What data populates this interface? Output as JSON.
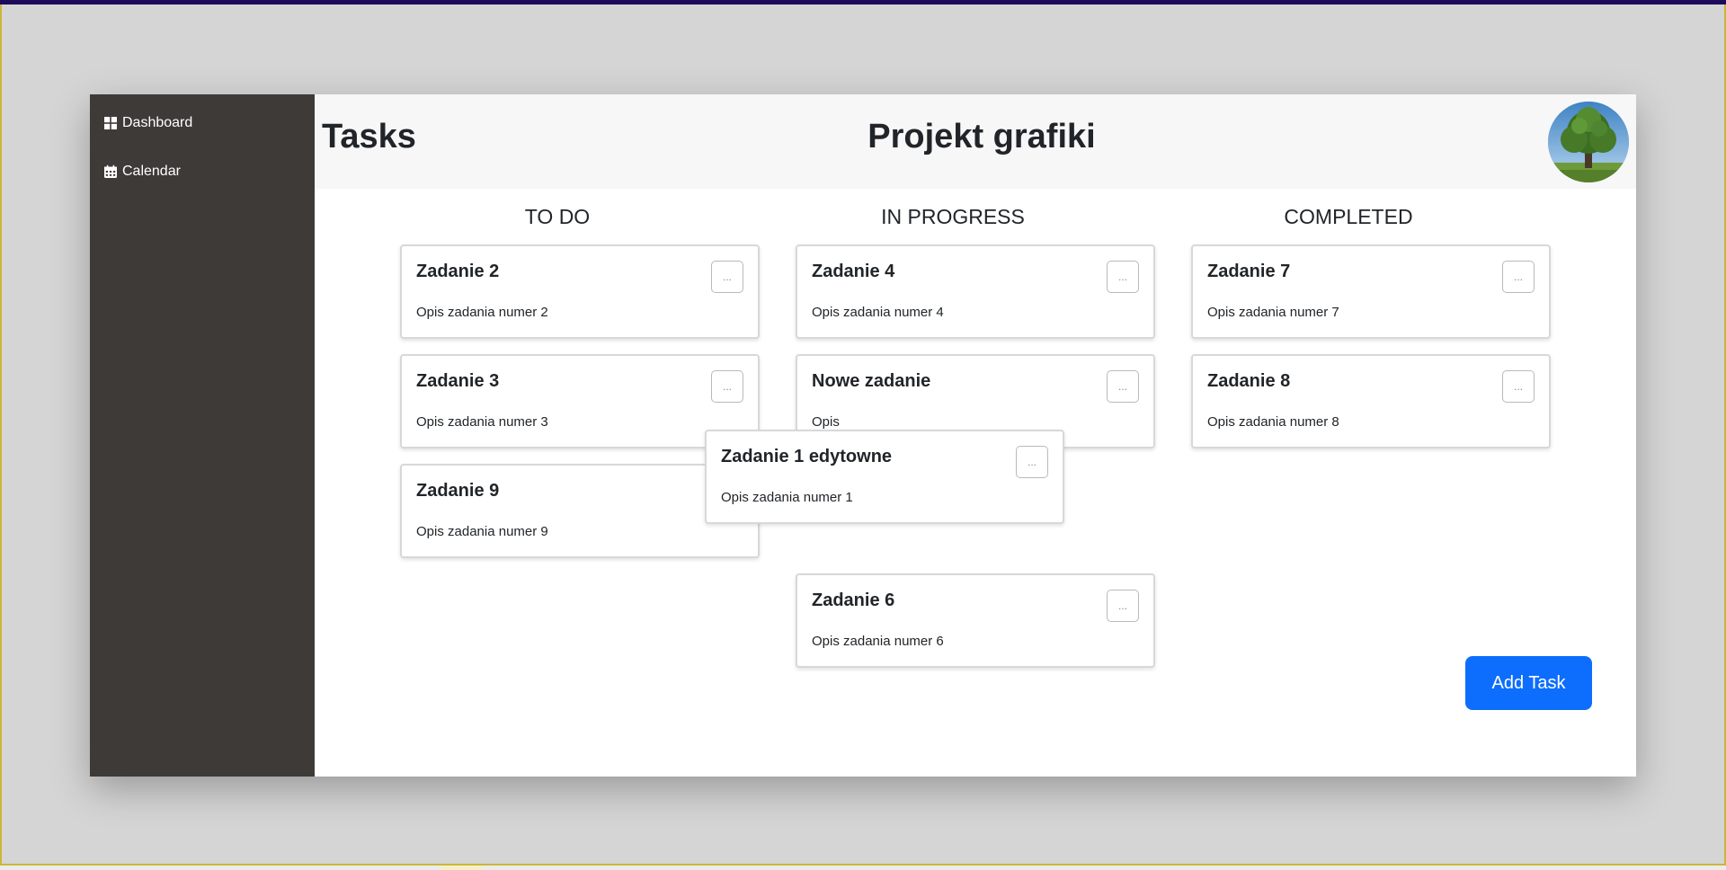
{
  "sidebar": {
    "items": [
      {
        "label": "Dashboard",
        "icon": "dashboard-icon"
      },
      {
        "label": "Calendar",
        "icon": "calendar-icon"
      }
    ]
  },
  "header": {
    "title": "Tasks",
    "project": "Projekt grafiki"
  },
  "columns": [
    {
      "title": "TO DO"
    },
    {
      "title": "IN PROGRESS"
    },
    {
      "title": "COMPLETED"
    }
  ],
  "cards": {
    "todo": [
      {
        "title": "Zadanie 2",
        "desc": "Opis zadania numer 2",
        "menu": "..."
      },
      {
        "title": "Zadanie 3",
        "desc": "Opis zadania numer 3",
        "menu": "..."
      },
      {
        "title": "Zadanie 9",
        "desc": "Opis zadania numer 9",
        "menu": "..."
      }
    ],
    "in_progress": [
      {
        "title": "Zadanie 4",
        "desc": "Opis zadania numer 4",
        "menu": "..."
      },
      {
        "title": "Nowe zadanie",
        "desc": "Opis",
        "menu": "..."
      },
      {
        "title": "Zadanie 6",
        "desc": "Opis zadania numer 6",
        "menu": "..."
      }
    ],
    "completed": [
      {
        "title": "Zadanie 7",
        "desc": "Opis zadania numer 7",
        "menu": "..."
      },
      {
        "title": "Zadanie 8",
        "desc": "Opis zadania numer 8",
        "menu": "..."
      }
    ],
    "dragging": {
      "title": "Zadanie 1 edytowne",
      "desc": "Opis zadania numer 1",
      "menu": "..."
    }
  },
  "actions": {
    "add_task": "Add Task"
  },
  "colors": {
    "sidebar": "#3d3a38",
    "accent": "#0d6efd",
    "header_bg": "#f7f7f7",
    "page_bg": "#d5d5d5"
  }
}
